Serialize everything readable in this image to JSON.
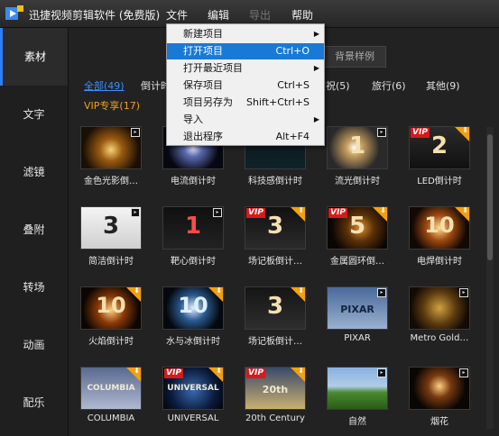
{
  "app": {
    "title": "迅捷视频剪辑软件 (免费版)"
  },
  "menu": {
    "file": "文件",
    "edit": "编辑",
    "export": "导出",
    "help": "帮助"
  },
  "sidebar": {
    "items": [
      {
        "label": "素材",
        "active": true
      },
      {
        "label": "文字"
      },
      {
        "label": "滤镜"
      },
      {
        "label": "叠附"
      },
      {
        "label": "转场"
      },
      {
        "label": "动画"
      },
      {
        "label": "配乐"
      }
    ]
  },
  "subtabs": {
    "bg_sample": "背景样例"
  },
  "categories": {
    "all": "全部(49)",
    "countdown": "倒计时",
    "celebration": "庆祝(5)",
    "travel": "旅行(6)",
    "other": "其他(9)",
    "vip": "VIP专享(17)"
  },
  "tiles": [
    {
      "label": "金色光影倒…",
      "thumb": "gold-light",
      "badge": "play"
    },
    {
      "label": "电流倒计时",
      "thumb": "electric",
      "badge": "play"
    },
    {
      "label": "科技感倒计时",
      "thumb": "tech",
      "badge": "play"
    },
    {
      "label": "流光倒计时",
      "thumb": "streamer",
      "badge": "play",
      "num": "1"
    },
    {
      "label": "LED倒计时",
      "thumb": "led",
      "badge": "vip",
      "num": "2"
    },
    {
      "label": "简洁倒计时",
      "thumb": "simple",
      "badge": "play",
      "num": "3"
    },
    {
      "label": "靶心倒计时",
      "thumb": "target",
      "badge": "play",
      "num": "1"
    },
    {
      "label": "场记板倒计…",
      "thumb": "clapper",
      "badge": "vip",
      "num": "3"
    },
    {
      "label": "金属圆环倒…",
      "thumb": "metal-ring",
      "badge": "vip",
      "num": "5"
    },
    {
      "label": "电焊倒计时",
      "thumb": "welding",
      "badge": "download",
      "num": "10"
    },
    {
      "label": "火焰倒计时",
      "thumb": "flame",
      "badge": "download",
      "num": "10"
    },
    {
      "label": "水与冰倒计时",
      "thumb": "water-ice",
      "badge": "download",
      "num": "10"
    },
    {
      "label": "场记板倒计…",
      "thumb": "clapper2",
      "badge": "download",
      "num": "3"
    },
    {
      "label": "PIXAR",
      "thumb": "pixar",
      "badge": "play",
      "text": "PIXAR"
    },
    {
      "label": "Metro Gold…",
      "thumb": "mgm",
      "badge": "play"
    },
    {
      "label": "COLUMBIA",
      "thumb": "columbia",
      "badge": "download",
      "text": "COLUMBIA"
    },
    {
      "label": "UNIVERSAL",
      "thumb": "universal",
      "badge": "vip",
      "text": "UNIVERSAL"
    },
    {
      "label": "20th Century",
      "thumb": "20th",
      "badge": "vip",
      "text": "20th"
    },
    {
      "label": "自然",
      "thumb": "nature",
      "badge": "play"
    },
    {
      "label": "烟花",
      "thumb": "fireworks",
      "badge": "play"
    }
  ],
  "dropdown": {
    "items": [
      {
        "label": "新建项目",
        "shortcut": "",
        "submenu": true
      },
      {
        "label": "打开项目",
        "shortcut": "Ctrl+O",
        "highlighted": true
      },
      {
        "label": "打开最近项目",
        "shortcut": "",
        "submenu": true
      },
      {
        "label": "保存项目",
        "shortcut": "Ctrl+S"
      },
      {
        "label": "项目另存为",
        "shortcut": "Shift+Ctrl+S"
      },
      {
        "label": "导入",
        "shortcut": "",
        "submenu": true
      },
      {
        "label": "退出程序",
        "shortcut": "Alt+F4"
      }
    ]
  },
  "badges": {
    "vip": "VIP",
    "download": "⬇",
    "play": "▸"
  },
  "colors": {
    "accent": "#2d7ef7",
    "vip": "#d71a1a",
    "download": "#f2a010",
    "highlight": "#1979d6"
  }
}
